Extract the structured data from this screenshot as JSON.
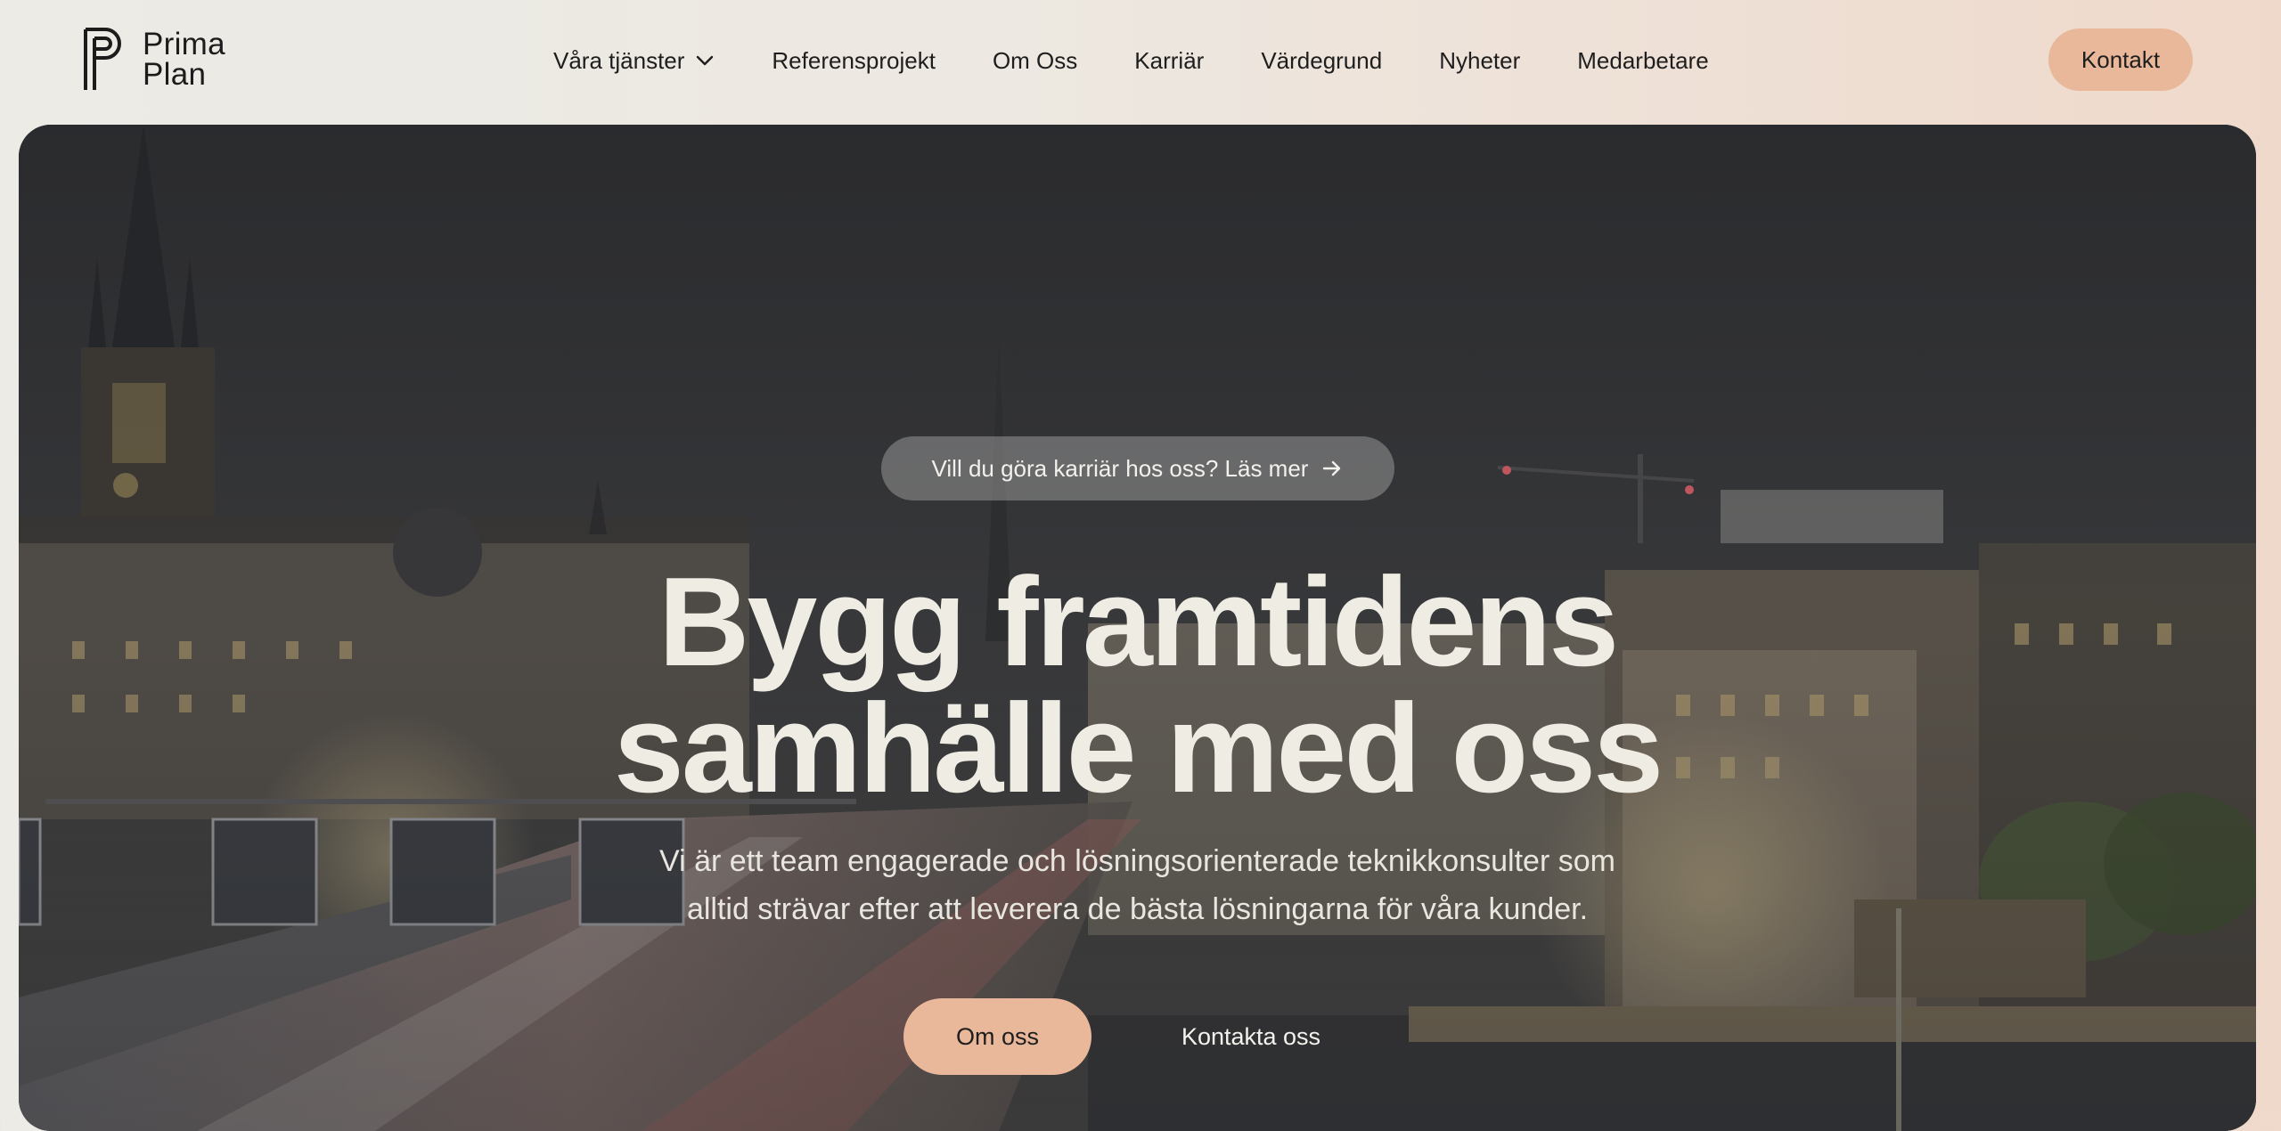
{
  "brand": {
    "line1": "Prima",
    "line2": "Plan"
  },
  "nav": {
    "items": [
      {
        "label": "Våra tjänster"
      },
      {
        "label": "Referensprojekt"
      },
      {
        "label": "Om Oss"
      },
      {
        "label": "Karriär"
      },
      {
        "label": "Värdegrund"
      },
      {
        "label": "Nyheter"
      },
      {
        "label": "Medarbetare"
      }
    ],
    "contact_label": "Kontakt"
  },
  "hero": {
    "banner_text": "Vill du göra karriär hos oss? Läs mer",
    "title_line1": "Bygg framtidens",
    "title_line2": "samhälle med oss",
    "subtitle_line1": "Vi är ett team engagerade och lösningsorienterade teknikkonsulter som",
    "subtitle_line2": "alltid strävar efter att leverera de bästa lösningarna för våra kunder.",
    "primary_button": "Om oss",
    "secondary_link": "Kontakta oss"
  },
  "colors": {
    "accent": "#e9b89a",
    "text_dark": "#1c1c1c",
    "hero_text": "#efece4"
  },
  "icons": {
    "dropdown": "chevron-down-icon",
    "banner_arrow": "arrow-right-icon"
  }
}
